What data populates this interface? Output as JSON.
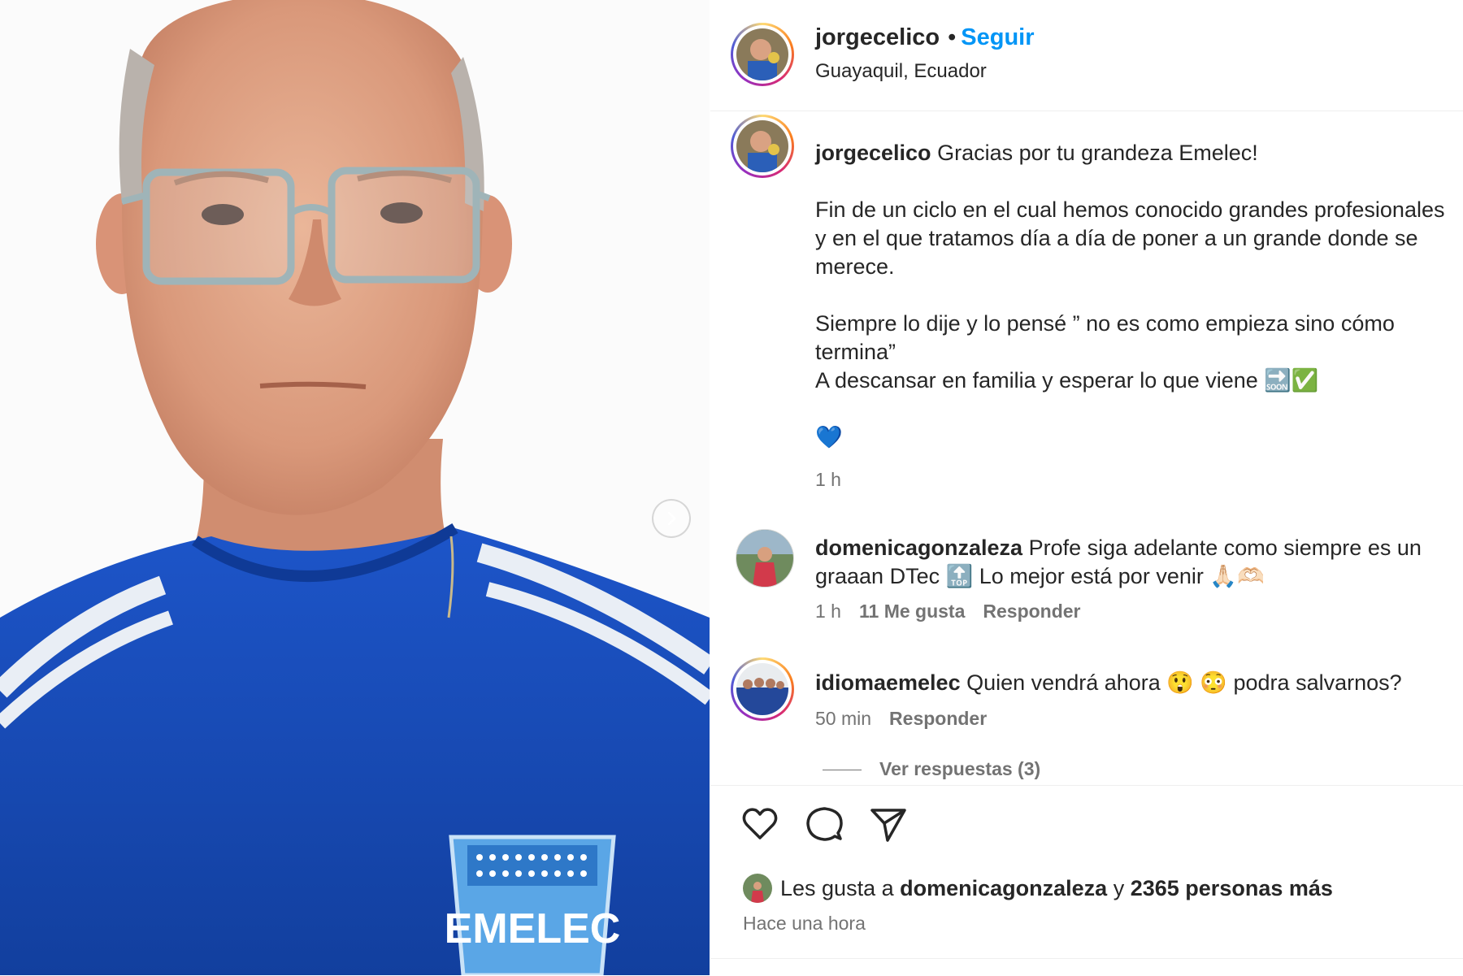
{
  "post": {
    "username": "jorgecelico",
    "separator": "•",
    "follow_label": "Seguir",
    "location": "Guayaquil, Ecuador",
    "caption_lines": [
      "Gracias por tu grandeza Emelec!",
      "",
      "Fin de un ciclo en el cual hemos conocido grandes profesionales y en el que tratamos día a día de poner a un grande donde se merece.",
      "",
      "Siempre lo dije y lo pensé ” no es como empieza sino cómo termina”",
      "A descansar en familia y esperar lo que viene 🔜✅",
      "",
      "💙"
    ],
    "caption_time": "1 h"
  },
  "comments": [
    {
      "username": "domenicagonzaleza",
      "text": "Profe siga adelante como siempre es un graaan DTec 🔝 Lo mejor está por venir 🙏🏻🫶🏻",
      "time": "1 h",
      "likes": "11 Me gusta",
      "reply_label": "Responder"
    },
    {
      "username": "idiomaemelec",
      "text": "Quien vendrá ahora 😲 😳  podra salvarnos?",
      "time": "50 min",
      "reply_label": "Responder",
      "view_replies": "Ver respuestas (3)"
    }
  ],
  "footer": {
    "likes_prefix": "Les gusta a",
    "likes_user": "domenicagonzaleza",
    "likes_conj": "y",
    "likes_rest": "2365 personas más",
    "time_ago": "Hace una hora"
  },
  "media": {
    "crest_text": "EMELEC"
  },
  "colors": {
    "accent": "#0095f6",
    "shirt": "#1747b8",
    "secondary_text": "#737373"
  },
  "icons": [
    "chevron-right-icon",
    "heart-icon",
    "comment-icon",
    "share-icon"
  ]
}
